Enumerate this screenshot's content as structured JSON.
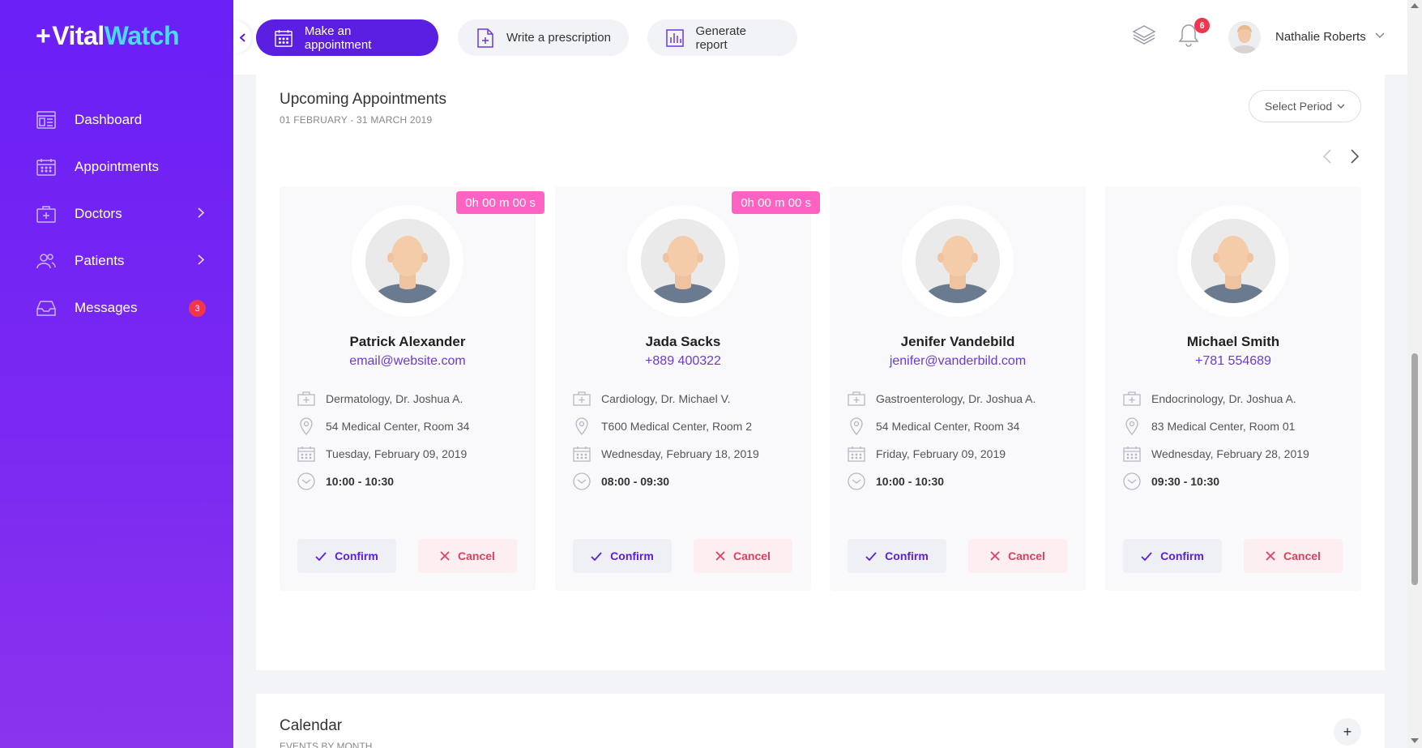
{
  "brand": {
    "plus": "+",
    "vital": "Vital",
    "watch": "Watch"
  },
  "sidebar": {
    "items": [
      {
        "label": "Dashboard",
        "icon": "dashboard-icon"
      },
      {
        "label": "Appointments",
        "icon": "calendar-icon"
      },
      {
        "label": "Doctors",
        "icon": "medical-kit-icon",
        "has_submenu": true
      },
      {
        "label": "Patients",
        "icon": "users-icon",
        "has_submenu": true
      },
      {
        "label": "Messages",
        "icon": "inbox-icon",
        "badge": "3"
      }
    ]
  },
  "toolbar": {
    "make_appointment": "Make an appointment",
    "write_prescription": "Write a prescription",
    "generate_report": "Generate report",
    "notifications_count": "6",
    "user_name": "Nathalie Roberts"
  },
  "upcoming": {
    "title": "Upcoming Appointments",
    "range": "01 FEBRUARY - 31 MARCH 2019",
    "period_label": "Select Period",
    "confirm_label": "Confirm",
    "cancel_label": "Cancel",
    "cards": [
      {
        "timer": "0h 00 m 00 s",
        "name": "Patrick Alexander",
        "contact": "email@website.com",
        "department": "Dermatology, Dr. Joshua A.",
        "location": "54 Medical Center, Room 34",
        "date": "Tuesday, February 09, 2019",
        "time": "10:00 - 10:30"
      },
      {
        "timer": "0h 00 m 00 s",
        "name": "Jada Sacks",
        "contact": "+889 400322",
        "department": "Cardiology, Dr. Michael V.",
        "location": "T600 Medical Center, Room 2",
        "date": "Wednesday, February 18, 2019",
        "time": "08:00 - 09:30"
      },
      {
        "timer": "",
        "name": "Jenifer Vandebild",
        "contact": "jenifer@vanderbild.com",
        "department": "Gastroenterology, Dr. Joshua A.",
        "location": "54 Medical Center, Room 34",
        "date": "Friday, February 09, 2019",
        "time": "10:00 - 10:30"
      },
      {
        "timer": "",
        "name": "Michael Smith",
        "contact": "+781 554689",
        "department": "Endocrinology, Dr. Joshua A.",
        "location": "83 Medical Center, Room 01",
        "date": "Wednesday, February 28, 2019",
        "time": "09:30 - 10:30"
      }
    ]
  },
  "calendar": {
    "title": "Calendar",
    "subtitle": "EVENTS BY MONTH",
    "add_label": "+"
  },
  "colors": {
    "sidebar_top": "#6a1ff6",
    "sidebar_bottom": "#8b34ee",
    "brand_accent": "#4fd8ff",
    "primary": "#5a1fe0",
    "timer": "#ff62c3",
    "cancel": "#e0405e",
    "badge": "#f0364c"
  }
}
